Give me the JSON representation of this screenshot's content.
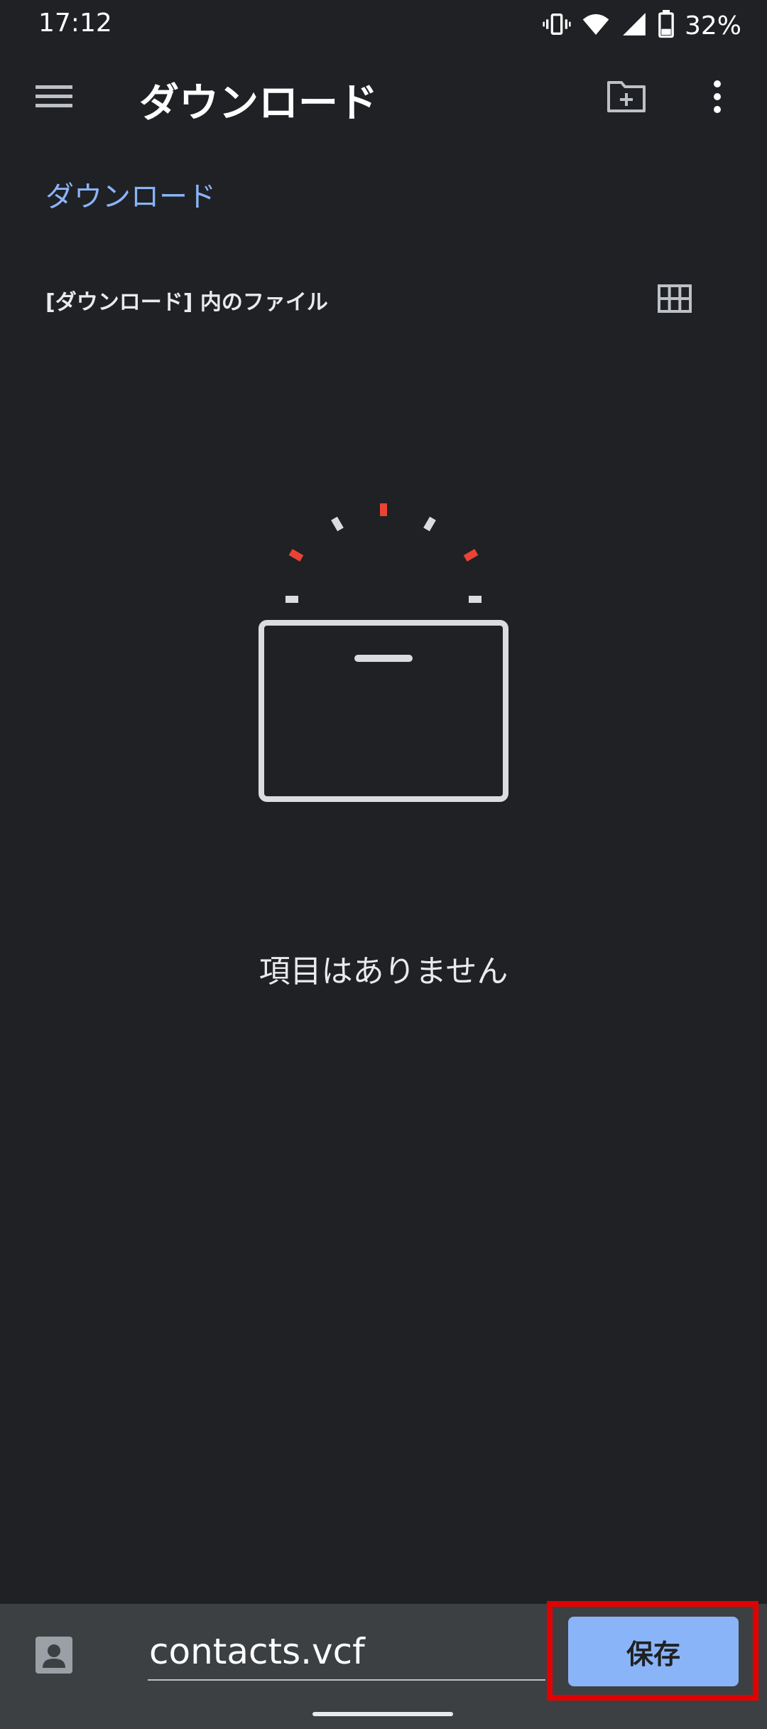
{
  "status_bar": {
    "time": "17:12",
    "battery_percent": "32%",
    "icons": [
      "vibrate-icon",
      "wifi-icon",
      "cellular-signal-icon",
      "battery-icon"
    ]
  },
  "app_bar": {
    "title": "ダウンロード",
    "icons": [
      "menu-icon",
      "new-folder-icon",
      "more-vert-icon"
    ]
  },
  "breadcrumb": {
    "label": "ダウンロード"
  },
  "section": {
    "header": "[ダウンロード] 内のファイル",
    "view_toggle_icon": "grid-view-icon"
  },
  "empty_state": {
    "message": "項目はありません"
  },
  "save_bar": {
    "contact_icon": "contact-icon",
    "filename": "contacts.vcf",
    "save_label": "保存"
  },
  "colors": {
    "background": "#202124",
    "accent": "#8ab4f8",
    "bottom_bar": "#3c4043",
    "highlight": "#e30000"
  }
}
